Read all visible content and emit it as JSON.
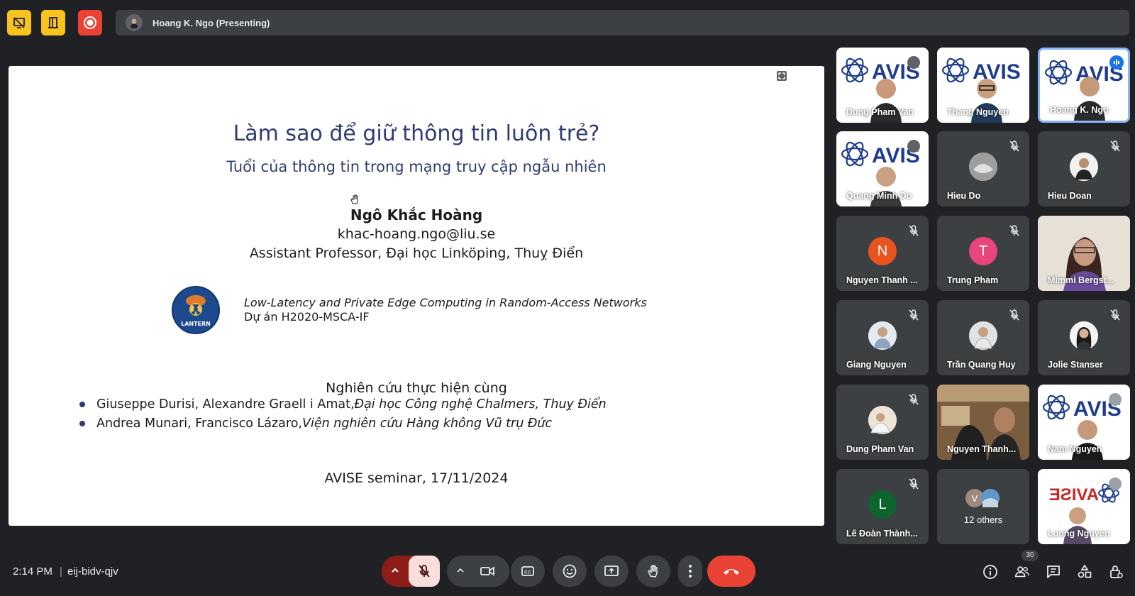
{
  "presenter": {
    "name": "Hoang K. Ngo (Presenting)"
  },
  "slide": {
    "title": "Làm sao để giữ thông tin luôn trẻ?",
    "subtitle": "Tuổi của thông tin trong mạng truy cập ngẫu nhiên",
    "author": "Ngô Khắc Hoàng",
    "email": "khac-hoang.ngo@liu.se",
    "position": "Assistant Professor, Đại học Linköping, Thuỵ Điển",
    "logo_text": "LANTERN",
    "project_title": "Low-Latency and Private Edge Computing in Random-Access Networks",
    "project_id": "Dự án H2020-MSCA-IF",
    "collab_heading": "Nghiên cứu thực hiện cùng",
    "collaborators": [
      {
        "names": "Giuseppe Durisi, Alexandre Graell i Amat, ",
        "affiliation": "Đại học Công nghệ Chalmers, Thuỵ Điển"
      },
      {
        "names": "Andrea Munari, Francisco Lázaro, ",
        "affiliation": "Viện nghiên cứu Hàng không Vũ trụ Đức"
      }
    ],
    "footer": "AVISE seminar, 17/11/2024"
  },
  "participants": [
    {
      "name": "Dung Pham Van"
    },
    {
      "name": "Thang Nguyen"
    },
    {
      "name": "Hoang K. Ngo"
    },
    {
      "name": "Quang Minh Do"
    },
    {
      "name": "Hieu Do"
    },
    {
      "name": "Hieu Doan"
    },
    {
      "name": "Nguyen Thanh ...",
      "initial": "N"
    },
    {
      "name": "Trung Pham",
      "initial": "T"
    },
    {
      "name": "Mimmi Bergst..."
    },
    {
      "name": "Giang Nguyen"
    },
    {
      "name": "Trần Quang Huy"
    },
    {
      "name": "Jolie Stanser"
    },
    {
      "name": "Dung Pham Van"
    },
    {
      "name": "Nguyen Thanh..."
    },
    {
      "name": "Nam Nguyen"
    },
    {
      "name": "Lê Đoàn Thành...",
      "initial": "L"
    },
    {
      "name": "12 others",
      "initial": "V"
    },
    {
      "name": "Luong Nguyen"
    }
  ],
  "avise_text": "AVIS",
  "avise_text_full": "AVISE",
  "bottom": {
    "time": "2:14 PM",
    "separator": "|",
    "meeting_code": "eij-bidv-qjv",
    "people_count": "30"
  },
  "colors": {
    "background": "#202124",
    "tile": "#3c4043",
    "accent_blue": "#8ab4f8",
    "leave_red": "#ea4335",
    "slide_title": "#2f3c73"
  },
  "icons": {
    "top": [
      "present-off-icon",
      "door-icon",
      "record-icon"
    ],
    "controls": [
      "chevron-up-icon",
      "mic-off-icon",
      "chevron-up-icon",
      "camera-icon",
      "captions-icon",
      "emoji-icon",
      "present-icon",
      "hand-icon",
      "more-icon",
      "end-call-icon"
    ],
    "right": [
      "info-icon",
      "people-icon",
      "chat-icon",
      "activities-icon",
      "lock-icon"
    ]
  }
}
